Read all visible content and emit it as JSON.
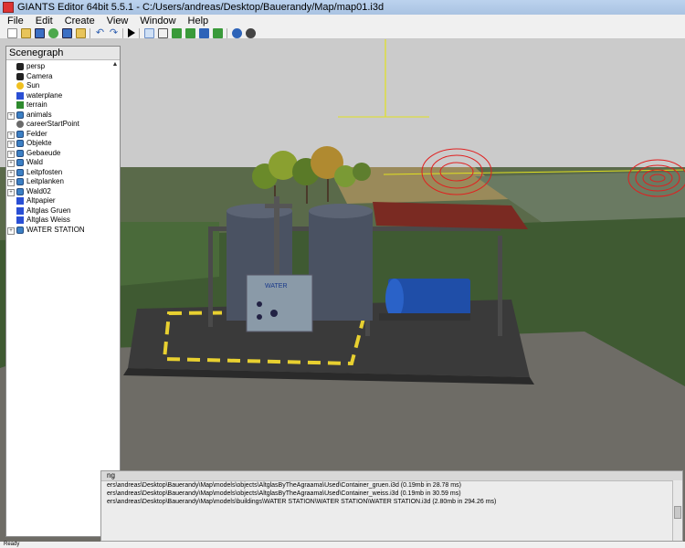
{
  "window": {
    "title": "GIANTS Editor 64bit 5.5.1 - C:/Users/andreas/Desktop/Bauerandy/Map/map01.i3d"
  },
  "menu": [
    "File",
    "Edit",
    "Create",
    "View",
    "Window",
    "Help"
  ],
  "toolbar": {
    "icons": [
      "new-icon",
      "open-icon",
      "save-icon",
      "reload-icon",
      "export-icon",
      "import-icon",
      "undo-icon",
      "redo-icon",
      "play-icon",
      "select-icon",
      "magnet-icon",
      "paint-icon",
      "terrain-icon",
      "foliage-icon",
      "decal-icon",
      "settings-icon",
      "camera-icon"
    ]
  },
  "scenegraph": {
    "title": "Scenegraph",
    "nodes": [
      {
        "label": "persp",
        "icon": "camera",
        "expandable": false
      },
      {
        "label": "Camera",
        "icon": "camera",
        "expandable": false
      },
      {
        "label": "Sun",
        "icon": "light",
        "expandable": false
      },
      {
        "label": "waterplane",
        "icon": "cube",
        "expandable": false
      },
      {
        "label": "terrain",
        "icon": "terrain",
        "expandable": false
      },
      {
        "label": "animals",
        "icon": "group",
        "expandable": true
      },
      {
        "label": "careerStartPoint",
        "icon": "transform",
        "expandable": false
      },
      {
        "label": "Felder",
        "icon": "group",
        "expandable": true
      },
      {
        "label": "Objekte",
        "icon": "group",
        "expandable": true
      },
      {
        "label": "Gebaeude",
        "icon": "group",
        "expandable": true
      },
      {
        "label": "Wald",
        "icon": "group",
        "expandable": true
      },
      {
        "label": "Leitpfosten",
        "icon": "group",
        "expandable": true
      },
      {
        "label": "Leitplanken",
        "icon": "group",
        "expandable": true
      },
      {
        "label": "Wald02",
        "icon": "group",
        "expandable": true
      },
      {
        "label": "Altpapier",
        "icon": "cube",
        "expandable": false
      },
      {
        "label": "Altglas Gruen",
        "icon": "cube",
        "expandable": false
      },
      {
        "label": "Altglas Weiss",
        "icon": "cube",
        "expandable": false
      },
      {
        "label": "WATER STATION",
        "icon": "group",
        "expandable": true
      }
    ]
  },
  "viewport": {
    "sign_text": "WATER"
  },
  "log": {
    "title": "ng",
    "lines": [
      "ers\\andreas\\Desktop\\Bauerandy\\Map\\models\\objects\\AltglasByTheAgraama\\Used\\Container_gruen.i3d (0.19mb in 28.78 ms)",
      "ers\\andreas\\Desktop\\Bauerandy\\Map\\models\\objects\\AltglasByTheAgraama\\Used\\Container_weiss.i3d (0.19mb in 30.59 ms)",
      "ers\\andreas\\Desktop\\Bauerandy\\Map\\models\\buildings\\WATER STATION\\WATER STATION\\WATER STATION.i3d (2.80mb in 294.26 ms)"
    ]
  },
  "status": {
    "text": "Ready"
  },
  "colors": {
    "sky": "#cbcbcb",
    "ground": "#3f5a32",
    "gravel": "#6e6c66",
    "platform": "#3a3a3a",
    "roof": "#7a2a22",
    "tank": "#4a5262",
    "pump": "#1f4ea8",
    "marking": "#e8d030"
  }
}
